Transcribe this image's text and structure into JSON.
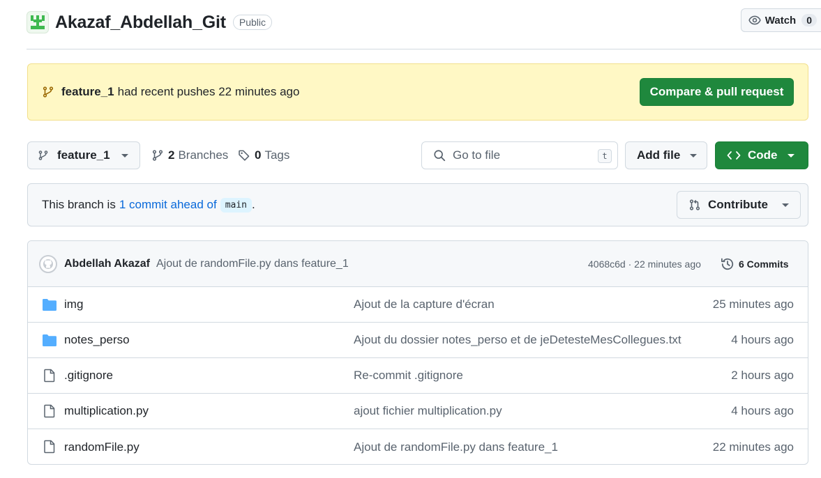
{
  "repo": {
    "name": "Akazaf_Abdellah_Git",
    "visibility": "Public",
    "watch_label": "Watch",
    "watch_count": "0"
  },
  "banner": {
    "branch": "feature_1",
    "message": "had recent pushes 22 minutes ago",
    "button_label": "Compare & pull request"
  },
  "toolbar": {
    "branch_label": "feature_1",
    "branches_count": "2",
    "branches_label": "Branches",
    "tags_count": "0",
    "tags_label": "Tags",
    "search_placeholder": "Go to file",
    "search_shortcut": "t",
    "add_file_label": "Add file",
    "code_label": "Code"
  },
  "ahead": {
    "prefix": "This branch is",
    "link_text": "1 commit ahead of",
    "base_branch": "main",
    "suffix": ".",
    "contribute_label": "Contribute"
  },
  "latest_commit": {
    "author": "Abdellah Akazaf",
    "message": "Ajout de randomFile.py dans feature_1",
    "meta": "4068c6d · 22 minutes ago",
    "commits_label": "6 Commits"
  },
  "files": [
    {
      "type": "folder",
      "name": "img",
      "commit": "Ajout de la capture d'écran",
      "age": "25 minutes ago"
    },
    {
      "type": "folder",
      "name": "notes_perso",
      "commit": "Ajout du dossier notes_perso et de jeDetesteMesCollegues.txt",
      "age": "4 hours ago"
    },
    {
      "type": "file",
      "name": ".gitignore",
      "commit": "Re-commit .gitignore",
      "age": "2 hours ago"
    },
    {
      "type": "file",
      "name": "multiplication.py",
      "commit": "ajout fichier multiplication.py",
      "age": "4 hours ago"
    },
    {
      "type": "file",
      "name": "randomFile.py",
      "commit": "Ajout de randomFile.py dans feature_1",
      "age": "22 minutes ago"
    }
  ],
  "colors": {
    "primary_green": "#1f883d",
    "banner_bg": "#fff8c5",
    "link_blue": "#0969da",
    "folder_blue": "#54aeff"
  }
}
